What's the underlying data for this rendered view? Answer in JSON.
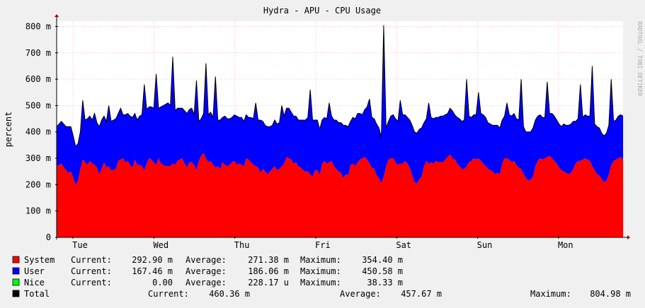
{
  "chart_data": {
    "type": "area",
    "stacked": true,
    "title": "Hydra - APU - CPU Usage",
    "ylabel": "percent",
    "xlabel": "",
    "ylim": [
      0,
      820
    ],
    "yticks": [
      0,
      100,
      200,
      300,
      400,
      500,
      600,
      700,
      800
    ],
    "ytick_labels": [
      "0",
      "100 m",
      "200 m",
      "300 m",
      "400 m",
      "500 m",
      "600 m",
      "700 m",
      "800 m"
    ],
    "x_categories": [
      "Tue",
      "Wed",
      "Thu",
      "Fri",
      "Sat",
      "Sun",
      "Mon"
    ],
    "grid": true,
    "watermark": "RRDTOOL / TOBI OETIKER",
    "series": [
      {
        "name": "System",
        "color": "#ff0000",
        "values": [
          270,
          275,
          280,
          265,
          255,
          245,
          250,
          225,
          200,
          215,
          260,
          295,
          285,
          275,
          290,
          280,
          275,
          265,
          240,
          260,
          285,
          265,
          270,
          255,
          255,
          260,
          290,
          295,
          300,
          285,
          290,
          275,
          265,
          295,
          275,
          275,
          270,
          255,
          280,
          300,
          295,
          285,
          275,
          300,
          280,
          275,
          270,
          270,
          270,
          280,
          275,
          290,
          295,
          300,
          280,
          265,
          285,
          285,
          275,
          255,
          290,
          310,
          320,
          300,
          285,
          290,
          275,
          265,
          270,
          260,
          285,
          275,
          270,
          275,
          285,
          290,
          275,
          280,
          275,
          270,
          300,
          295,
          285,
          275,
          270,
          265,
          245,
          260,
          250,
          240,
          250,
          260,
          270,
          255,
          260,
          270,
          280,
          305,
          300,
          295,
          280,
          285,
          270,
          265,
          255,
          250,
          250,
          240,
          230,
          255,
          255,
          235,
          280,
          290,
          280,
          285,
          290,
          270,
          260,
          250,
          245,
          225,
          240,
          235,
          275,
          280,
          270,
          285,
          295,
          300,
          305,
          295,
          280,
          265,
          260,
          235,
          225,
          205,
          230,
          270,
          295,
          300,
          300,
          285,
          275,
          280,
          280,
          290,
          280,
          265,
          235,
          210,
          205,
          220,
          230,
          270,
          290,
          280,
          285,
          280,
          290,
          285,
          285,
          285,
          295,
          305,
          315,
          300,
          295,
          280,
          270,
          260,
          260,
          270,
          285,
          290,
          300,
          295,
          300,
          290,
          280,
          270,
          260,
          255,
          250,
          240,
          245,
          240,
          280,
          300,
          300,
          295,
          285,
          290,
          275,
          265,
          260,
          240,
          225,
          215,
          220,
          230,
          270,
          290,
          300,
          295,
          300,
          305,
          310,
          300,
          290,
          280,
          265,
          255,
          250,
          245,
          240,
          245,
          260,
          280,
          290,
          290,
          295,
          300,
          295,
          290,
          270,
          255,
          240,
          235,
          220,
          210,
          215,
          240,
          275,
          290,
          295,
          300,
          305,
          295
        ]
      },
      {
        "name": "User",
        "color": "#0000ff",
        "values": [
          150,
          155,
          160,
          165,
          165,
          175,
          170,
          160,
          145,
          140,
          140,
          150,
          160,
          175,
          170,
          165,
          165,
          170,
          180,
          185,
          175,
          175,
          190,
          185,
          190,
          190,
          180,
          175,
          165,
          180,
          180,
          185,
          190,
          175,
          170,
          185,
          195,
          210,
          205,
          195,
          200,
          205,
          210,
          190,
          215,
          225,
          235,
          240,
          230,
          220,
          205,
          200,
          195,
          190,
          200,
          205,
          200,
          205,
          190,
          175,
          150,
          140,
          150,
          160,
          180,
          185,
          180,
          180,
          175,
          185,
          170,
          185,
          180,
          175,
          170,
          175,
          185,
          175,
          180,
          170,
          165,
          160,
          170,
          175,
          180,
          180,
          200,
          180,
          175,
          180,
          170,
          165,
          175,
          175,
          175,
          170,
          180,
          185,
          190,
          180,
          180,
          175,
          175,
          180,
          190,
          195,
          205,
          210,
          215,
          190,
          190,
          175,
          165,
          165,
          170,
          170,
          170,
          175,
          185,
          185,
          190,
          200,
          185,
          185,
          165,
          175,
          180,
          185,
          175,
          165,
          180,
          200,
          195,
          190,
          190,
          195,
          190,
          175,
          170,
          145,
          145,
          160,
          165,
          165,
          165,
          170,
          185,
          175,
          175,
          180,
          190,
          190,
          190,
          190,
          185,
          165,
          160,
          165,
          170,
          170,
          165,
          170,
          175,
          175,
          170,
          165,
          175,
          180,
          170,
          175,
          180,
          180,
          185,
          185,
          175,
          165,
          165,
          170,
          175,
          180,
          185,
          185,
          175,
          175,
          175,
          185,
          180,
          175,
          165,
          160,
          170,
          170,
          175,
          180,
          175,
          180,
          175,
          180,
          175,
          185,
          180,
          185,
          175,
          170,
          165,
          160,
          155,
          160,
          160,
          170,
          170,
          165,
          165,
          165,
          180,
          180,
          185,
          185,
          180,
          160,
          160,
          160,
          160,
          165,
          165,
          170,
          160,
          175,
          180,
          180,
          175,
          175,
          180,
          185,
          165,
          150,
          150,
          160,
          160,
          165,
          170,
          165
        ]
      },
      {
        "name": "Nice",
        "color": "#00ff00",
        "values": [
          0,
          0,
          0,
          0,
          0,
          0,
          0,
          0,
          0,
          0,
          0,
          0,
          0,
          0,
          0,
          0,
          0,
          0,
          0,
          0,
          0,
          0,
          0,
          0,
          0,
          0,
          0,
          0,
          0,
          0,
          0,
          0,
          0,
          0,
          0,
          0,
          0,
          0,
          0,
          0,
          0,
          0,
          0,
          0,
          0,
          0,
          0,
          0,
          0,
          0,
          0,
          0,
          0,
          0,
          0,
          0,
          0,
          0,
          0,
          0,
          0,
          0,
          0,
          0,
          0,
          0,
          0,
          0,
          0,
          0,
          0,
          0,
          0,
          0,
          0,
          0,
          0,
          0,
          0,
          0,
          0,
          0,
          0,
          0,
          0,
          0,
          0,
          0,
          0,
          0,
          0,
          0,
          0,
          0,
          0,
          0,
          0,
          0,
          0,
          0,
          0,
          0,
          0,
          0,
          0,
          0,
          0,
          0,
          0,
          0,
          0,
          0,
          0,
          0,
          0,
          0,
          0,
          0,
          0,
          0,
          0,
          0,
          0,
          0,
          0,
          0,
          0,
          0,
          0,
          0,
          0,
          0,
          0,
          0,
          0,
          0,
          0,
          0,
          0,
          0,
          0,
          0,
          0,
          0,
          0,
          0,
          0,
          0,
          0,
          0,
          0,
          0,
          0,
          0,
          0,
          0,
          0,
          0,
          0,
          0,
          0,
          0,
          0,
          0,
          0,
          0,
          0,
          0,
          0,
          0,
          0,
          0,
          0,
          0,
          0,
          0,
          0,
          0,
          0,
          0,
          0,
          0,
          0,
          0,
          0,
          0,
          0,
          0,
          0,
          0,
          0,
          0,
          0,
          0,
          0,
          0,
          0,
          0,
          0,
          0,
          0,
          0,
          0,
          0,
          0,
          0,
          0,
          0,
          0,
          0,
          0,
          0,
          0,
          0,
          0,
          0,
          0,
          0,
          0,
          0,
          0,
          0,
          0,
          0,
          0,
          0,
          0,
          0,
          0,
          0,
          0,
          0,
          0,
          0,
          0,
          0,
          0,
          0,
          0,
          0,
          0,
          0,
          0,
          0,
          0,
          0,
          0,
          0,
          0,
          0
        ]
      }
    ],
    "spikes": [
      {
        "index": 11,
        "total": 520
      },
      {
        "index": 16,
        "total": 470
      },
      {
        "index": 22,
        "total": 500
      },
      {
        "index": 27,
        "total": 490
      },
      {
        "index": 37,
        "total": 580
      },
      {
        "index": 42,
        "total": 620
      },
      {
        "index": 49,
        "total": 685
      },
      {
        "index": 59,
        "total": 595
      },
      {
        "index": 63,
        "total": 660
      },
      {
        "index": 67,
        "total": 610
      },
      {
        "index": 84,
        "total": 510
      },
      {
        "index": 95,
        "total": 500
      },
      {
        "index": 107,
        "total": 560
      },
      {
        "index": 115,
        "total": 510
      },
      {
        "index": 132,
        "total": 525
      },
      {
        "index": 138,
        "total": 805
      },
      {
        "index": 145,
        "total": 520
      },
      {
        "index": 157,
        "total": 510
      },
      {
        "index": 173,
        "total": 600
      },
      {
        "index": 178,
        "total": 550
      },
      {
        "index": 190,
        "total": 510
      },
      {
        "index": 196,
        "total": 600
      },
      {
        "index": 207,
        "total": 590
      },
      {
        "index": 221,
        "total": 580
      },
      {
        "index": 226,
        "total": 650
      },
      {
        "index": 234,
        "total": 600
      },
      {
        "index": 241,
        "total": 595
      },
      {
        "index": 249,
        "total": 620
      }
    ]
  },
  "legend": [
    {
      "name": "System",
      "color": "#ff0000",
      "current_label": "Current:",
      "current": "292.90 m",
      "average_label": "Average:",
      "average": "271.38 m",
      "maximum_label": "Maximum:",
      "maximum": "354.40 m"
    },
    {
      "name": "User",
      "color": "#0000ff",
      "current_label": "Current:",
      "current": "167.46 m",
      "average_label": "Average:",
      "average": "186.06 m",
      "maximum_label": "Maximum:",
      "maximum": "450.58 m"
    },
    {
      "name": "Nice",
      "color": "#00ff00",
      "current_label": "Current:",
      "current": "0.00",
      "average_label": "Average:",
      "average": "228.17 u",
      "maximum_label": "Maximum:",
      "maximum": "38.33 m"
    }
  ],
  "total": {
    "name": "Total",
    "color": "#000000",
    "current_label": "Current:",
    "current": "460.36 m",
    "average_label": "Average:",
    "average": "457.67 m",
    "maximum_label": "Maximum:",
    "maximum": "804.98 m"
  }
}
